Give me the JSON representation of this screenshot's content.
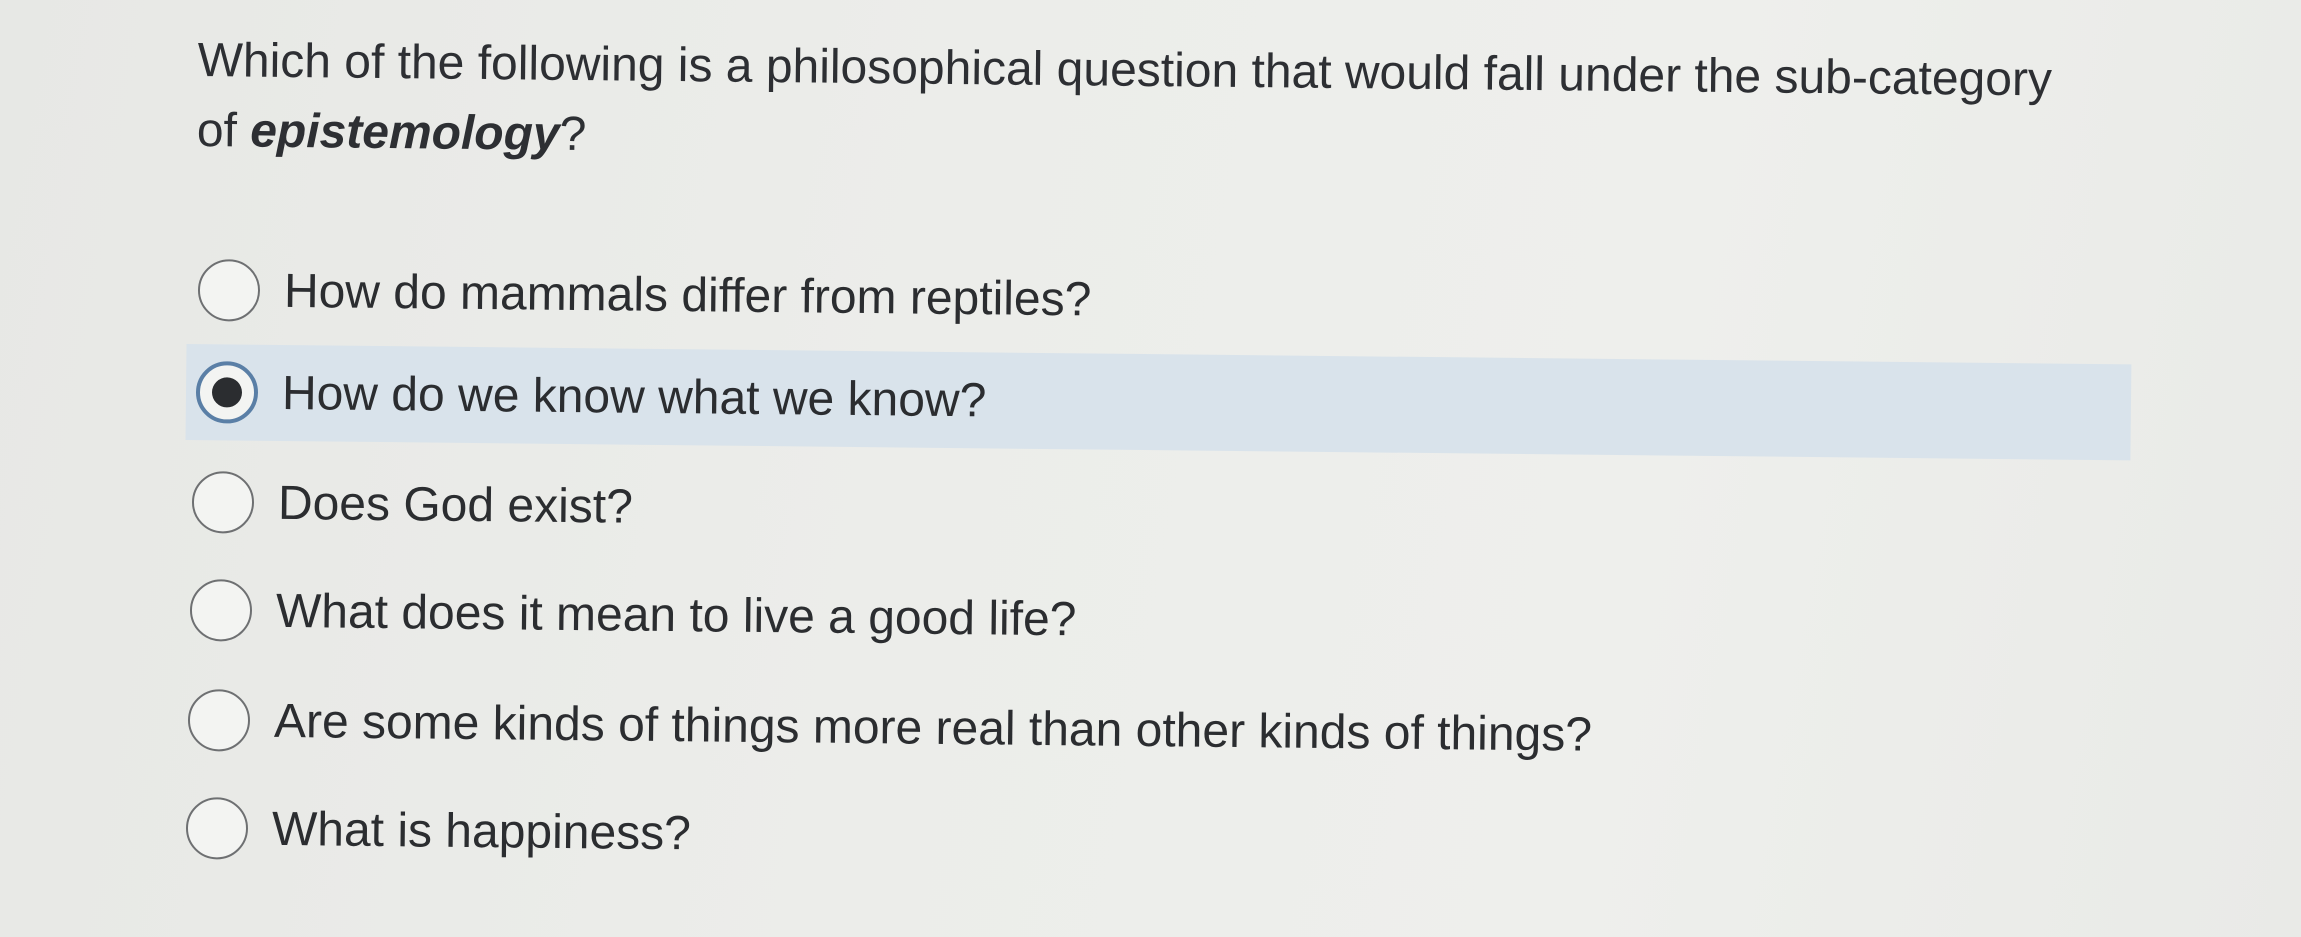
{
  "question": {
    "text_before": "Which of the following is a philosophical question that would fall under the sub-category of ",
    "emphasis": "epistemology",
    "text_after": "?"
  },
  "options": [
    {
      "label": "How do mammals differ from reptiles?",
      "selected": false
    },
    {
      "label": "How do we know what we know?",
      "selected": true
    },
    {
      "label": "Does God exist?",
      "selected": false
    },
    {
      "label": "What does it mean to live a good life?",
      "selected": false
    },
    {
      "label": "Are some kinds of things more real than other kinds of things?",
      "selected": false
    },
    {
      "label": "What is happiness?",
      "selected": false
    }
  ],
  "colors": {
    "selected_row": "#d9e3eb",
    "radio_checked_ring": "#5a7fa6",
    "text": "#2b2d30"
  }
}
